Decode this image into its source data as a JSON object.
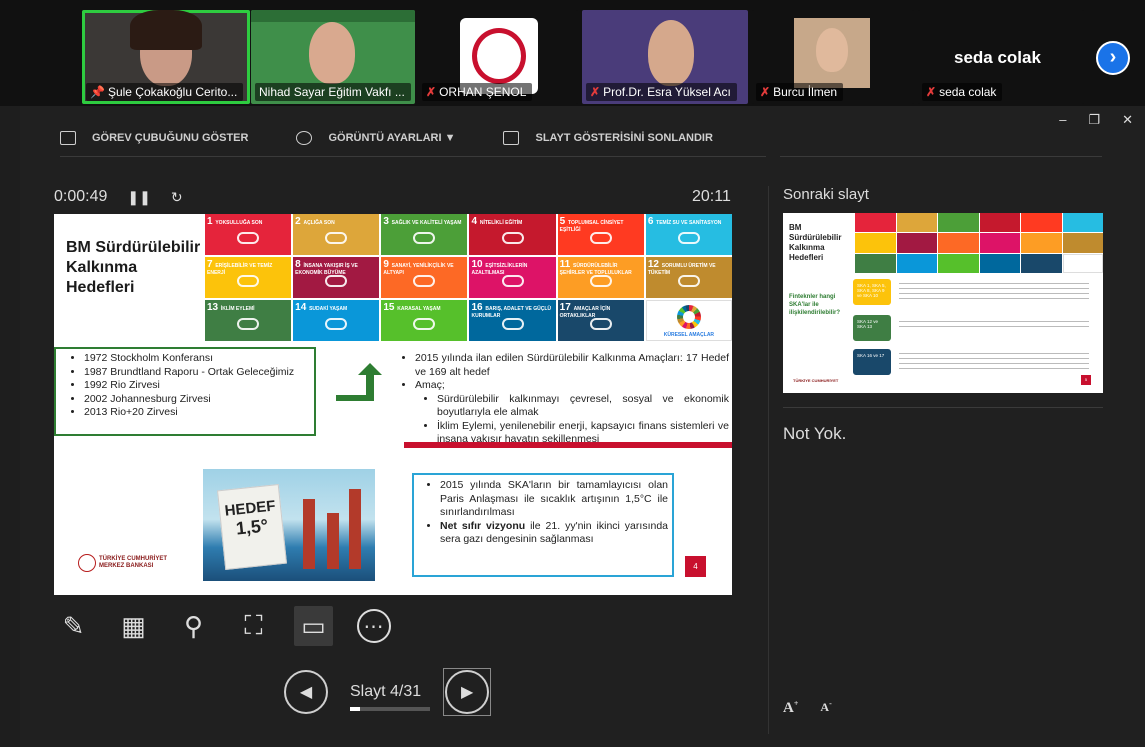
{
  "participants": [
    {
      "name": "Şule Çokakoğlu Cerito...",
      "muted": false,
      "pinned": true
    },
    {
      "name": "Nihad Sayar Eğitim Vakfı ...",
      "muted": false,
      "pinned": false
    },
    {
      "name": "ORHAN ŞENOL",
      "muted": true,
      "pinned": false
    },
    {
      "name": "Prof.Dr. Esra Yüksel Acı",
      "muted": true,
      "pinned": false
    },
    {
      "name": "Burcu İlmen",
      "muted": true,
      "pinned": false
    },
    {
      "name": "seda colak",
      "muted": true,
      "pinned": false
    }
  ],
  "big_name": "seda colak",
  "toolbar": {
    "taskbar_label": "GÖREV ÇUBUĞUNU GÖSTER",
    "display_label": "GÖRÜNTÜ AYARLARI ▼",
    "end_label": "SLAYT GÖSTERİSİNİ SONLANDIR"
  },
  "timer": "0:00:49",
  "clock": "20:11",
  "slide": {
    "title": "BM Sürdürülebilir Kalkınma Hedefleri",
    "sdgs": [
      {
        "n": "1",
        "label": "YOKSULLUĞA SON",
        "color": "#e5243b"
      },
      {
        "n": "2",
        "label": "AÇLIĞA SON",
        "color": "#dda63a"
      },
      {
        "n": "3",
        "label": "SAĞLIK VE KALİTELİ YAŞAM",
        "color": "#4c9f38"
      },
      {
        "n": "4",
        "label": "NİTELİKLİ EĞİTİM",
        "color": "#c5192d"
      },
      {
        "n": "5",
        "label": "TOPLUMSAL CİNSİYET EŞİTLİĞİ",
        "color": "#ff3a21"
      },
      {
        "n": "6",
        "label": "TEMİZ SU VE SANİTASYON",
        "color": "#26bde2"
      },
      {
        "n": "7",
        "label": "ERİŞİLEBİLİR VE TEMİZ ENERJİ",
        "color": "#fcc30b"
      },
      {
        "n": "8",
        "label": "İNSANA YAKIŞIR İŞ VE EKONOMİK BÜYÜME",
        "color": "#a21942"
      },
      {
        "n": "9",
        "label": "SANAYİ, YENİLİKÇİLİK VE ALTYAPI",
        "color": "#fd6925"
      },
      {
        "n": "10",
        "label": "EŞİTSİZLİKLERİN AZALTILMASI",
        "color": "#dd1367"
      },
      {
        "n": "11",
        "label": "SÜRDÜRÜLEBİLİR ŞEHİRLER VE TOPLULUKLAR",
        "color": "#fd9d24"
      },
      {
        "n": "12",
        "label": "SORUMLU ÜRETİM VE TÜKETİM",
        "color": "#bf8b2e"
      },
      {
        "n": "13",
        "label": "İKLİM EYLEMİ",
        "color": "#3f7e44"
      },
      {
        "n": "14",
        "label": "SUDAKİ YAŞAM",
        "color": "#0a97d9"
      },
      {
        "n": "15",
        "label": "KARASAL YAŞAM",
        "color": "#56c02b"
      },
      {
        "n": "16",
        "label": "BARIŞ, ADALET VE GÜÇLÜ KURUMLAR",
        "color": "#00689d"
      },
      {
        "n": "17",
        "label": "AMAÇLAR İÇİN ORTAKLIKLAR",
        "color": "#19486a"
      }
    ],
    "wheel_label": "KÜRESEL AMAÇLAR",
    "history": [
      "1972 Stockholm Konferansı",
      "1987 Brundtland Raporu - Ortak Geleceğimiz",
      "1992 Rio Zirvesi",
      "2002 Johannesburg Zirvesi",
      "2013 Rio+20 Zirvesi"
    ],
    "right_bullets": [
      "2015 yılında ilan edilen Sürdürülebilir Kalkınma Amaçları: 17 Hedef ve 169 alt hedef",
      "Amaç;"
    ],
    "sub_bullets": [
      "Sürdürülebilir kalkınmayı çevresel, sosyal ve ekonomik boyutlarıyla ele almak",
      "İklim Eylemi, yenilenebilir enerji, kapsayıcı finans sistemleri ve insana yakışır hayatın şekillenmesi"
    ],
    "sign_top": "HEDEF",
    "sign_value": "1,5°",
    "paris_1": "2015 yılında SKA'ların bir tamamlayıcısı olan Paris Anlaşması ile sıcaklık artışının 1,5°C ile sınırlandırılması",
    "paris_2_bold": "Net sıfır vizyonu",
    "paris_2_rest": " ile 21. yy'nin ikinci yarısında sera gazı dengesinin sağlanması",
    "bank_line1": "TÜRKİYE CUMHURİYET",
    "bank_line2": "MERKEZ BANKASI",
    "page_number": "4"
  },
  "slide_counter": "Slayt 4/31",
  "progress_fraction": 0.129,
  "next_slide_label": "Sonraki slayt",
  "next_slide": {
    "title": "BM Sürdürülebilir Kalkınma Hedefleri",
    "question": "Finteknler hangi SKA'lar ile ilişkilendirilebilir?",
    "chips": [
      "SKA 1, SKA 5, SKA 8, SKA 9 ve SKA 10",
      "SKA 12 ve SKA 13",
      "SKA 16 ve 17"
    ],
    "page_number": "5"
  },
  "notes": "Not Yok.",
  "font_increase": "A",
  "font_decrease": "A"
}
